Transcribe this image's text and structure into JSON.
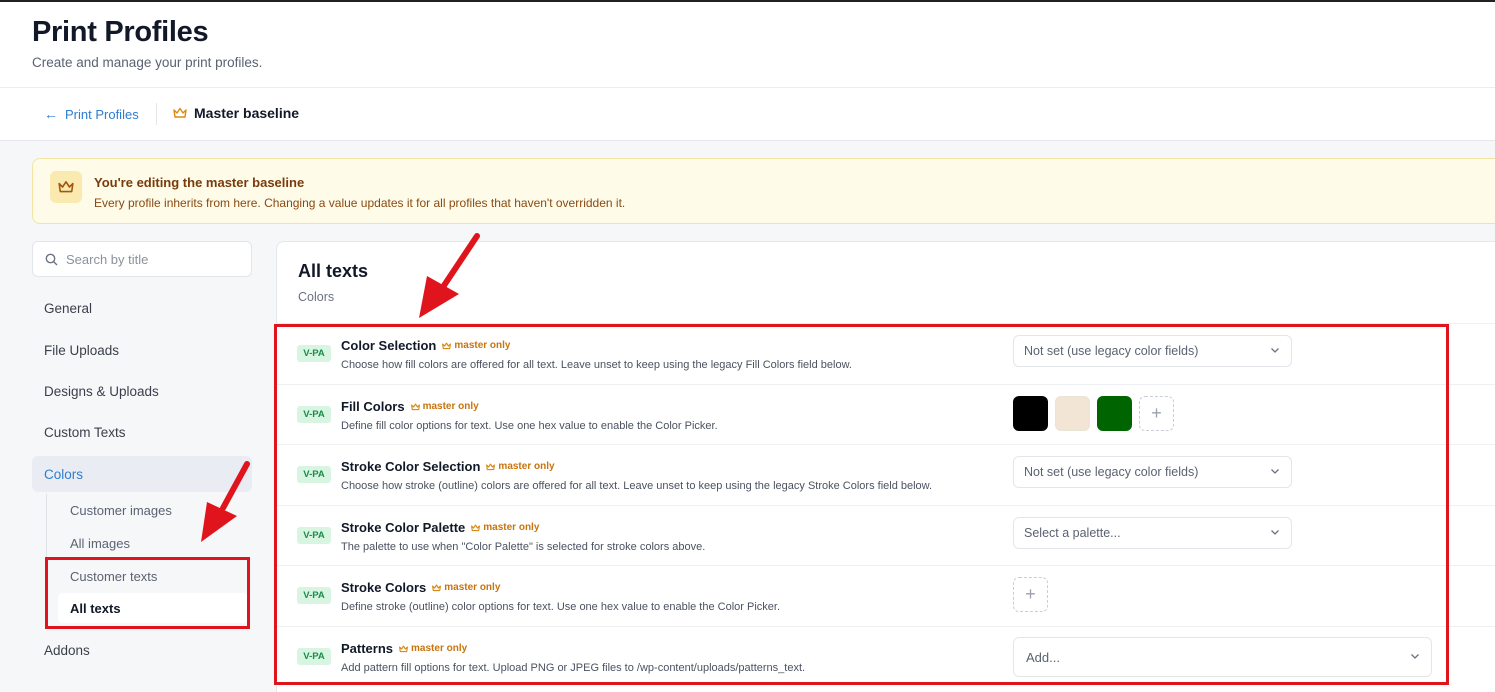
{
  "header": {
    "title": "Print Profiles",
    "subtitle": "Create and manage your print profiles."
  },
  "breadcrumb": {
    "back_label": "Print Profiles",
    "current_label": "Master baseline"
  },
  "banner": {
    "title": "You're editing the master baseline",
    "text": "Every profile inherits from here. Changing a value updates it for all profiles that haven't overridden it."
  },
  "sidebar": {
    "search_placeholder": "Search by title",
    "items": [
      {
        "label": "General"
      },
      {
        "label": "File Uploads"
      },
      {
        "label": "Designs & Uploads"
      },
      {
        "label": "Custom Texts"
      },
      {
        "label": "Colors"
      },
      {
        "label": "Addons"
      }
    ],
    "sub_items": [
      {
        "label": "Customer images"
      },
      {
        "label": "All images"
      },
      {
        "label": "Customer texts"
      },
      {
        "label": "All texts"
      }
    ]
  },
  "panel": {
    "title": "All texts",
    "subtitle": "Colors",
    "badge": "V-PA",
    "master_only_label": "master only",
    "rows": [
      {
        "title": "Color Selection",
        "description": "Choose how fill colors are offered for all text. Leave unset to keep using the legacy Fill Colors field below.",
        "control_value": "Not set (use legacy color fields)"
      },
      {
        "title": "Fill Colors",
        "description": "Define fill color options for text. Use one hex value to enable the Color Picker.",
        "swatches": [
          "#000000",
          "#f3e5d6",
          "#006400"
        ],
        "add_label": "+"
      },
      {
        "title": "Stroke Color Selection",
        "description": "Choose how stroke (outline) colors are offered for all text. Leave unset to keep using the legacy Stroke Colors field below.",
        "control_value": "Not set (use legacy color fields)"
      },
      {
        "title": "Stroke Color Palette",
        "description": "The palette to use when \"Color Palette\" is selected for stroke colors above.",
        "control_value": "Select a palette..."
      },
      {
        "title": "Stroke Colors",
        "description": "Define stroke (outline) color options for text. Use one hex value to enable the Color Picker.",
        "add_label": "+"
      },
      {
        "title": "Patterns",
        "description": "Add pattern fill options for text. Upload PNG or JPEG files to /wp-content/uploads/patterns_text.",
        "control_value": "Add..."
      }
    ]
  },
  "colors": {
    "accent": "#2e7dd1",
    "annotation": "#e0141c",
    "master_only": "#c8740d",
    "badge_bg": "#d8f5e2",
    "badge_text": "#1d8a4b"
  },
  "icons": {
    "back": "arrow-left-icon",
    "crown": "crown-icon",
    "search": "search-icon",
    "chevron": "chevron-down-icon",
    "add": "plus-icon"
  }
}
